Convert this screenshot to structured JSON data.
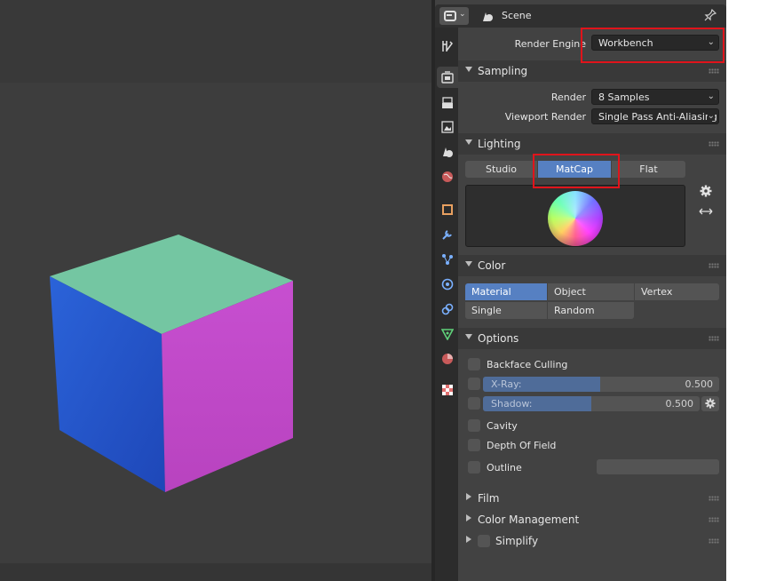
{
  "header": {
    "scene_label": "Scene",
    "editor_type_icon": "properties-editor-icon",
    "scene_icon": "scene-icon",
    "pin_icon": "pin-icon"
  },
  "tabs": [
    {
      "name": "tool",
      "icon": "tool-icon"
    },
    {
      "name": "render",
      "icon": "render-icon",
      "active": true
    },
    {
      "name": "output",
      "icon": "output-icon"
    },
    {
      "name": "view-layer",
      "icon": "view-layer-icon"
    },
    {
      "name": "scene",
      "icon": "scene-icon"
    },
    {
      "name": "world",
      "icon": "world-icon"
    },
    {
      "name": "object",
      "icon": "object-icon"
    },
    {
      "name": "modifiers",
      "icon": "wrench-icon"
    },
    {
      "name": "particles",
      "icon": "particles-icon"
    },
    {
      "name": "physics",
      "icon": "physics-icon"
    },
    {
      "name": "constraints",
      "icon": "constraints-icon"
    },
    {
      "name": "data",
      "icon": "mesh-data-icon"
    },
    {
      "name": "material",
      "icon": "material-icon"
    },
    {
      "name": "texture",
      "icon": "texture-icon"
    }
  ],
  "render_engine": {
    "label": "Render Engine",
    "value": "Workbench"
  },
  "sampling": {
    "title": "Sampling",
    "render_label": "Render",
    "render_value": "8 Samples",
    "viewport_label": "Viewport Render",
    "viewport_value": "Single Pass Anti-Aliasing"
  },
  "lighting": {
    "title": "Lighting",
    "modes": [
      "Studio",
      "MatCap",
      "Flat"
    ],
    "selected": "MatCap"
  },
  "color": {
    "title": "Color",
    "options": [
      "Material",
      "Object",
      "Vertex",
      "Single",
      "Random"
    ],
    "selected": "Material"
  },
  "options": {
    "title": "Options",
    "backface_culling": "Backface Culling",
    "xray_label": "X-Ray:",
    "xray_value": "0.500",
    "shadow_label": "Shadow:",
    "shadow_value": "0.500",
    "cavity": "Cavity",
    "depth_of_field": "Depth Of Field",
    "outline": "Outline"
  },
  "collapsed_sections": {
    "film": "Film",
    "color_management": "Color Management",
    "simplify": "Simplify"
  },
  "colors": {
    "accent": "#5680c2",
    "highlight": "#e0141b",
    "cube_top": "#74c6a2",
    "cube_left": "#2150c8",
    "cube_right": "#c04ac6"
  }
}
